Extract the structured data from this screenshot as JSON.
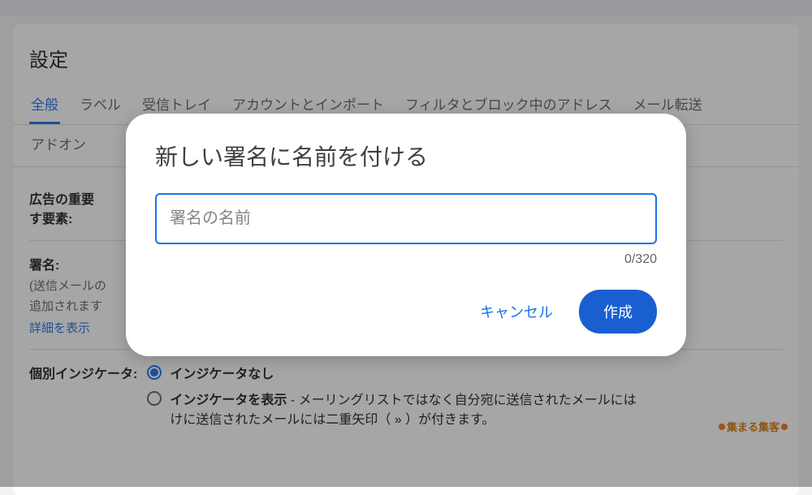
{
  "page": {
    "title": "設定"
  },
  "tabs": {
    "general": "全般",
    "labels": "ラベル",
    "inbox": "受信トレイ",
    "accounts": "アカウントとインポート",
    "filters": "フィルタとブロック中のアドレス",
    "forwarding": "メール転送",
    "addons": "アドオン"
  },
  "sections": {
    "ad_importance_label": "広告の重要",
    "ad_importance_sub": "す要素:",
    "signature_label": "署名:",
    "signature_desc1": "(送信メールの",
    "signature_desc2": "追加されます",
    "show_details": "詳細を表示",
    "indicator_label": "個別インジケータ:",
    "indicator_opt1": "インジケータなし",
    "indicator_opt2_bold": "インジケータを表示",
    "indicator_opt2_desc": " - メーリングリストではなく自分宛に送信されたメールには",
    "indicator_opt2_line2": "けに送信されたメールには二重矢印（ » ）が付きます。"
  },
  "dialog": {
    "title": "新しい署名に名前を付ける",
    "placeholder": "署名の名前",
    "char_count": "0/320",
    "cancel": "キャンセル",
    "create": "作成"
  },
  "watermark": "集まる集客"
}
